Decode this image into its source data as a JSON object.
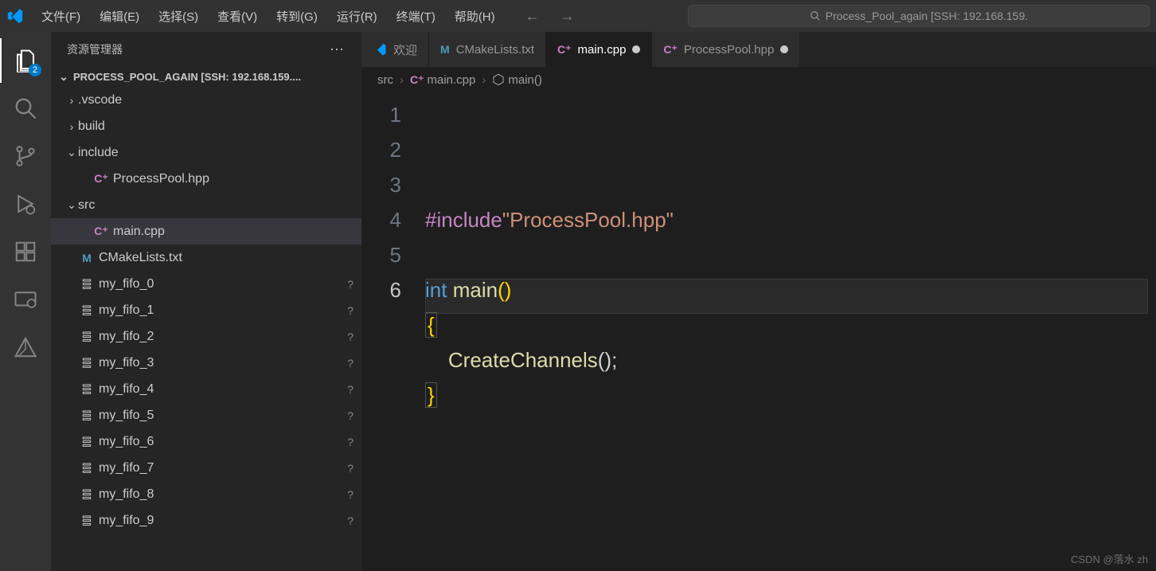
{
  "titlebar": {
    "menu": [
      "文件(F)",
      "编辑(E)",
      "选择(S)",
      "查看(V)",
      "转到(G)",
      "运行(R)",
      "终端(T)",
      "帮助(H)"
    ],
    "search_text": "Process_Pool_again [SSH: 192.168.159."
  },
  "activity": {
    "badge": "2"
  },
  "explorer": {
    "title": "资源管理器",
    "root": "PROCESS_POOL_AGAIN [SSH: 192.168.159....",
    "items": [
      {
        "type": "folder",
        "open": false,
        "label": ".vscode",
        "ind": 0
      },
      {
        "type": "folder",
        "open": false,
        "label": "build",
        "ind": 0
      },
      {
        "type": "folder",
        "open": true,
        "label": "include",
        "ind": 0
      },
      {
        "type": "file",
        "icon": "cpp",
        "label": "ProcessPool.hpp",
        "ind": 1
      },
      {
        "type": "folder",
        "open": true,
        "label": "src",
        "ind": 0
      },
      {
        "type": "file",
        "icon": "cpp",
        "label": "main.cpp",
        "ind": 1,
        "active": true
      },
      {
        "type": "file",
        "icon": "cmake",
        "label": "CMakeLists.txt",
        "ind": 0
      },
      {
        "type": "file",
        "icon": "txt",
        "label": "my_fifo_0",
        "ind": 0,
        "status": "?"
      },
      {
        "type": "file",
        "icon": "txt",
        "label": "my_fifo_1",
        "ind": 0,
        "status": "?"
      },
      {
        "type": "file",
        "icon": "txt",
        "label": "my_fifo_2",
        "ind": 0,
        "status": "?"
      },
      {
        "type": "file",
        "icon": "txt",
        "label": "my_fifo_3",
        "ind": 0,
        "status": "?"
      },
      {
        "type": "file",
        "icon": "txt",
        "label": "my_fifo_4",
        "ind": 0,
        "status": "?"
      },
      {
        "type": "file",
        "icon": "txt",
        "label": "my_fifo_5",
        "ind": 0,
        "status": "?"
      },
      {
        "type": "file",
        "icon": "txt",
        "label": "my_fifo_6",
        "ind": 0,
        "status": "?"
      },
      {
        "type": "file",
        "icon": "txt",
        "label": "my_fifo_7",
        "ind": 0,
        "status": "?"
      },
      {
        "type": "file",
        "icon": "txt",
        "label": "my_fifo_8",
        "ind": 0,
        "status": "?"
      },
      {
        "type": "file",
        "icon": "txt",
        "label": "my_fifo_9",
        "ind": 0,
        "status": "?"
      }
    ]
  },
  "tabs": [
    {
      "icon": "vs",
      "label": "欢迎",
      "dirty": false,
      "active": false
    },
    {
      "icon": "cmake",
      "label": "CMakeLists.txt",
      "dirty": false,
      "active": false
    },
    {
      "icon": "cpp",
      "label": "main.cpp",
      "dirty": true,
      "active": true
    },
    {
      "icon": "cpp",
      "label": "ProcessPool.hpp",
      "dirty": true,
      "active": false
    }
  ],
  "crumbs": {
    "a": "src",
    "b": "main.cpp",
    "c": "main()"
  },
  "code": {
    "lines": [
      {
        "n": "1",
        "seg": [
          {
            "c": "tok-macro",
            "t": "#include"
          },
          {
            "c": "tok-str",
            "t": "\"ProcessPool.hpp\""
          }
        ]
      },
      {
        "n": "2",
        "seg": []
      },
      {
        "n": "3",
        "seg": [
          {
            "c": "tok-kw",
            "t": "int"
          },
          {
            "c": "",
            "t": " "
          },
          {
            "c": "tok-fn",
            "t": "main"
          },
          {
            "c": "tok-brace",
            "t": "()"
          }
        ]
      },
      {
        "n": "4",
        "seg": [
          {
            "c": "tok-brace bracket-box",
            "t": "{"
          }
        ]
      },
      {
        "n": "5",
        "seg": [
          {
            "c": "",
            "t": "    "
          },
          {
            "c": "tok-fn",
            "t": "CreateChannels"
          },
          {
            "c": "tok-punc",
            "t": "();"
          }
        ]
      },
      {
        "n": "6",
        "seg": [
          {
            "c": "tok-brace bracket-box",
            "t": "}"
          }
        ],
        "cur": true
      }
    ]
  },
  "watermark": "CSDN @落水 zh"
}
